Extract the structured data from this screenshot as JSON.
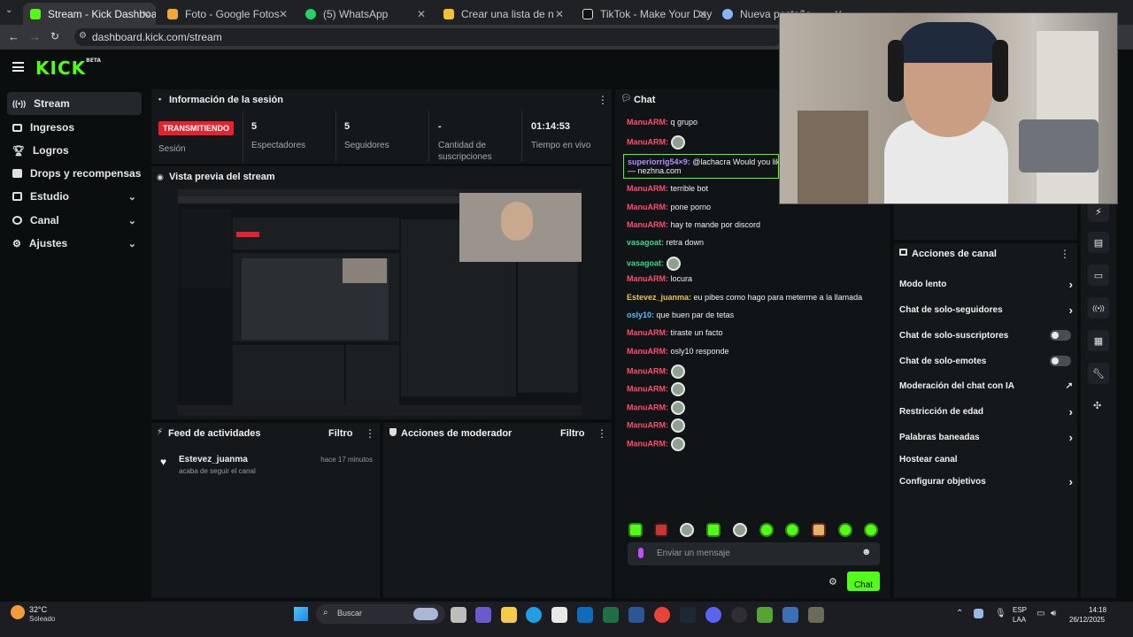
{
  "browser": {
    "tabs": [
      {
        "label": "Stream - Kick Dashboard",
        "active": true,
        "color": "#53fc18"
      },
      {
        "label": "Foto - Google Fotos",
        "color": "#f3a63b"
      },
      {
        "label": "(5) WhatsApp",
        "color": "#25d366"
      },
      {
        "label": "Crear una lista de niveles de st",
        "color": "#f2c230"
      },
      {
        "label": "TikTok - Make Your Day",
        "color": "#ffffff"
      },
      {
        "label": "Nueva pestaña",
        "color": "#8ab4f8"
      }
    ],
    "url": "dashboard.kick.com/stream"
  },
  "kick": {
    "logo": "KICK",
    "logo_badge": "BETA"
  },
  "sidebar": {
    "items": [
      {
        "label": "Stream",
        "icon": "broadcast-icon",
        "selected": true
      },
      {
        "label": "Ingresos",
        "icon": "revenue-icon"
      },
      {
        "label": "Logros",
        "icon": "trophy-icon"
      },
      {
        "label": "Drops y recompensas",
        "icon": "gift-icon"
      },
      {
        "label": "Estudio",
        "icon": "studio-icon",
        "chevron": true
      },
      {
        "label": "Canal",
        "icon": "channel-icon",
        "chevron": true
      },
      {
        "label": "Ajustes",
        "icon": "gear-icon",
        "chevron": true
      }
    ]
  },
  "session": {
    "title": "Información de la sesión",
    "status_badge": "TRANSMITIENDO",
    "status_label": "Sesión",
    "viewers": "5",
    "viewers_label": "Espectadores",
    "followers": "5",
    "followers_label": "Seguidores",
    "subs": "-",
    "subs_label": "Cantidad de suscripciones",
    "uptime": "01:14:53",
    "uptime_label": "Tiempo en vivo"
  },
  "preview": {
    "title": "Vista previa del stream"
  },
  "activity": {
    "title": "Feed de actividades",
    "filter": "Filtro",
    "items": [
      {
        "user": "Estevez_juanma",
        "text": "acaba de seguir el canal",
        "time": "hace 17 minutos"
      }
    ]
  },
  "mod_actions": {
    "title": "Acciones de moderador",
    "filter": "Filtro"
  },
  "chat": {
    "title": "Chat",
    "messages": [
      {
        "user": "ManuARM",
        "color": "#ff4d6d",
        "text": "q grupo"
      },
      {
        "user": "ManuARM",
        "color": "#ff4d6d",
        "text": "",
        "emote": true
      },
      {
        "user": "superiorrig54×9",
        "color": "#b38bff",
        "text": "@lachacra Would you lik",
        "cont": "— nezhna.com"
      },
      {
        "user": "ManuARM",
        "color": "#ff4d6d",
        "text": "terrible bot"
      },
      {
        "user": "ManuARM",
        "color": "#ff4d6d",
        "text": "pone porno"
      },
      {
        "user": "ManuARM",
        "color": "#ff4d6d",
        "text": "hay te mande por discord"
      },
      {
        "user": "vasagoat",
        "color": "#39d98a",
        "text": "retra down"
      },
      {
        "user": "vasagoat",
        "color": "#39d98a",
        "text": "",
        "emote": true
      },
      {
        "user": "ManuARM",
        "color": "#ff4d6d",
        "text": "locura"
      },
      {
        "user": "Estevez_juanma",
        "color": "#e8c547",
        "text": "eu pibes como hago para meterme a la llamada"
      },
      {
        "user": "osly10",
        "color": "#4cc3ff",
        "text": "que buen par de tetas"
      },
      {
        "user": "ManuARM",
        "color": "#ff4d6d",
        "text": "tiraste un facto"
      },
      {
        "user": "ManuARM",
        "color": "#ff4d6d",
        "text": "osly10 responde"
      },
      {
        "user": "ManuARM",
        "color": "#ff4d6d",
        "text": "",
        "emote": true
      },
      {
        "user": "ManuARM",
        "color": "#ff4d6d",
        "text": "",
        "emote": true
      },
      {
        "user": "ManuARM",
        "color": "#ff4d6d",
        "text": "",
        "emote": true
      },
      {
        "user": "ManuARM",
        "color": "#ff4d6d",
        "text": "",
        "emote": true
      },
      {
        "user": "ManuARM",
        "color": "#ff4d6d",
        "text": "",
        "emote": true
      }
    ],
    "input_placeholder": "Enviar un mensaje",
    "send_label": "Chat"
  },
  "channel_actions": {
    "title": "Acciones de canal",
    "items": [
      {
        "label": "Modo lento",
        "control": "chevron"
      },
      {
        "label": "Chat de solo-seguidores",
        "control": "chevron"
      },
      {
        "label": "Chat de solo-suscriptores",
        "control": "toggle"
      },
      {
        "label": "Chat de solo-emotes",
        "control": "toggle"
      },
      {
        "label": "Moderación del chat con IA",
        "control": "external"
      },
      {
        "label": "Restricción de edad",
        "control": "chevron"
      },
      {
        "label": "Palabras baneadas",
        "control": "chevron"
      },
      {
        "label": "Hostear canal",
        "control": "none"
      },
      {
        "label": "Configurar objetivos",
        "control": "chevron"
      }
    ]
  },
  "taskbar": {
    "weather_temp": "32°C",
    "weather_desc": "Soleado",
    "search_label": "Buscar",
    "lang_top": "ESP",
    "lang_bottom": "LAA",
    "time": "14:18",
    "date": "26/12/2025"
  },
  "colors": {
    "kick_green": "#53fc18",
    "live_red": "#e5232f"
  }
}
